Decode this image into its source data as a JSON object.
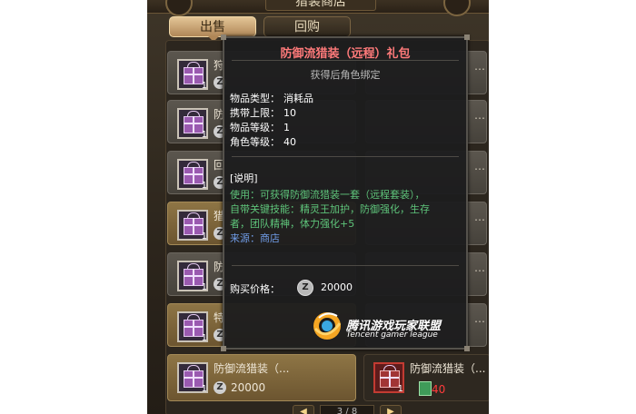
{
  "shop_title": "猎装商店",
  "tabs": [
    {
      "label": "出售",
      "active": true
    },
    {
      "label": "回购",
      "active": false
    }
  ],
  "currency_symbol": "Z",
  "items_left": [
    {
      "name": "狩",
      "count": "1",
      "style": "grey"
    },
    {
      "name": "防",
      "count": "1",
      "style": "grey"
    },
    {
      "name": "回",
      "count": "1",
      "style": "grey"
    },
    {
      "name": "猎",
      "count": "1",
      "style": "gold"
    },
    {
      "name": "防",
      "count": "1",
      "style": "grey"
    },
    {
      "name": "特",
      "count": "1",
      "style": "gold"
    }
  ],
  "bottom_items": [
    {
      "name": "防御流猎装（...",
      "count": "1",
      "price": "20000",
      "style": "gold"
    },
    {
      "name": "防御流猎装（...",
      "count": "1",
      "price": "40",
      "style": "dark"
    }
  ],
  "pager": {
    "text": "3 / 8",
    "prev": "◀",
    "next": "▶"
  },
  "tooltip": {
    "title": "防御流猎装（远程）礼包",
    "bind_note": "获得后角色绑定",
    "stats": [
      {
        "label": "物品类型：",
        "value": "消耗品"
      },
      {
        "label": "携带上限：",
        "value": "10"
      },
      {
        "label": "物品等级：",
        "value": "1"
      },
      {
        "label": "角色等级：",
        "value": "40"
      }
    ],
    "desc_header": "[说明]",
    "desc_lines": [
      "使用：可获得防御流猎装一套（远程套装），",
      "自带关键技能：精灵王加护，防御强化，生存",
      "者，团队精神，体力强化+5"
    ],
    "source_label": "来源：",
    "source_value": "商店",
    "price_label": "购买价格：",
    "price_value": "20000"
  },
  "watermark": {
    "title": "腾讯游戏玩家联盟",
    "subtitle": "Tencent gamer league"
  },
  "colors": {
    "tooltip_title": "#ff7a7a",
    "desc_green": "#5ec47a",
    "source_blue": "#6f9ce6",
    "price_red": "#ff3b3b"
  }
}
